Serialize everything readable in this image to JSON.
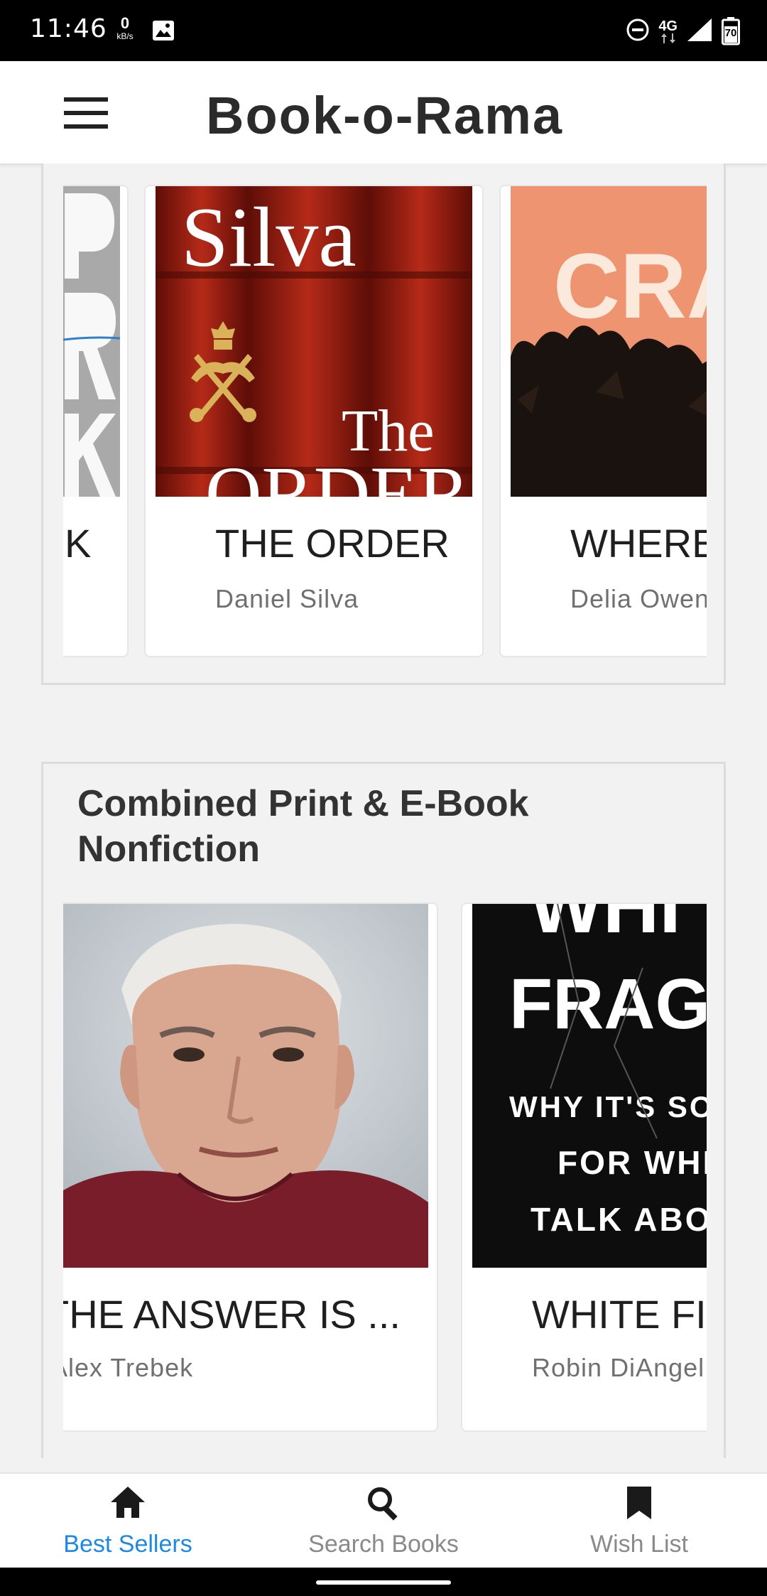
{
  "status_bar": {
    "time": "11:46",
    "net_speed_value": "0",
    "net_speed_unit": "kB/s",
    "network_type": "4G",
    "battery": "70"
  },
  "app_bar": {
    "title": "Book-o-Rama"
  },
  "sections": [
    {
      "title": "",
      "books": [
        {
          "title": "K",
          "author": "",
          "cover_text": ""
        },
        {
          "title": "THE ORDER",
          "author": "Daniel Silva",
          "cover_text": "Silva"
        },
        {
          "title": "WHERE",
          "author": "Delia Owen",
          "cover_text": "CRA"
        }
      ]
    },
    {
      "title": "Combined Print & E-Book Nonfiction",
      "books": [
        {
          "title": "THE ANSWER IS ...",
          "author": "Alex Trebek"
        },
        {
          "title": "WHITE FI",
          "author": "Robin DiAngel",
          "cover_lines": [
            "FRAGI",
            "WHY IT'S SO HA",
            "FOR WHITE",
            "TALK ABOUT"
          ]
        }
      ]
    }
  ],
  "bottom_nav": {
    "items": [
      {
        "label": "Best Sellers",
        "icon": "home-icon",
        "active": true
      },
      {
        "label": "Search Books",
        "icon": "search-icon",
        "active": false
      },
      {
        "label": "Wish List",
        "icon": "bookmark-icon",
        "active": false
      }
    ]
  },
  "colors": {
    "accent": "#1e88e5",
    "app_bar_bg": "#ffffff",
    "page_bg": "#f2f2f2"
  }
}
